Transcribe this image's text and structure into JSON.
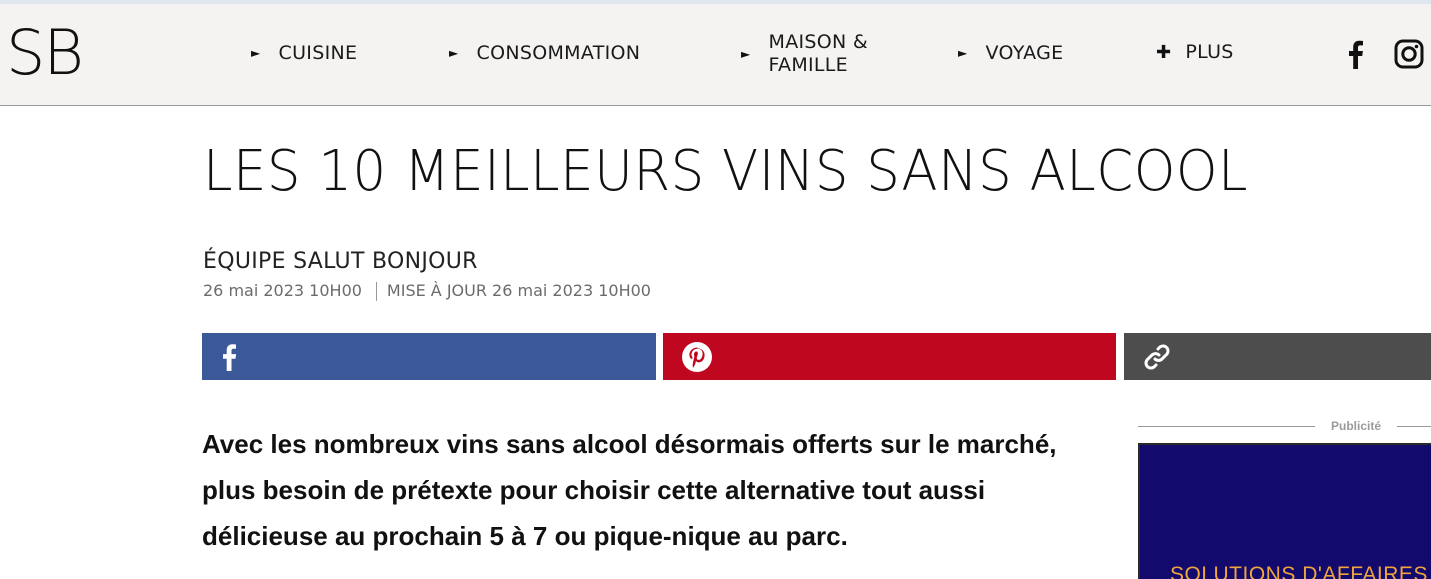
{
  "header": {
    "logo": "SB",
    "nav": [
      {
        "label": "CUISINE",
        "marker": "►"
      },
      {
        "label": "CONSOMMATION",
        "marker": "►"
      },
      {
        "label_line1": "MAISON &",
        "label_line2": "FAMILLE",
        "marker": "►"
      },
      {
        "label": "VOYAGE",
        "marker": "►"
      },
      {
        "label": "PLUS",
        "marker": "✚"
      }
    ],
    "social": [
      "facebook-icon",
      "instagram-icon"
    ]
  },
  "article": {
    "title": "LES 10 MEILLEURS VINS SANS ALCOOL",
    "author": "ÉQUIPE SALUT BONJOUR",
    "published": "26 mai 2023 10H00",
    "updated": "MISE À JOUR 26 mai 2023 10H00",
    "lead": "Avec les nombreux vins sans alcool désormais offerts sur le marché, plus besoin de prétexte pour choisir cette alternative tout aussi délicieuse au prochain 5 à 7 ou pique-nique au parc."
  },
  "share": {
    "facebook_color": "#3b5998",
    "pinterest_color": "#bf0820",
    "link_color": "#4d4d4d",
    "icons": [
      "facebook-icon",
      "pinterest-icon",
      "link-icon"
    ]
  },
  "ad": {
    "label": "Publicité",
    "text": "SOLUTIONS D'AFFAIRES",
    "background": "#130a6e",
    "text_color": "#f0a43c"
  }
}
